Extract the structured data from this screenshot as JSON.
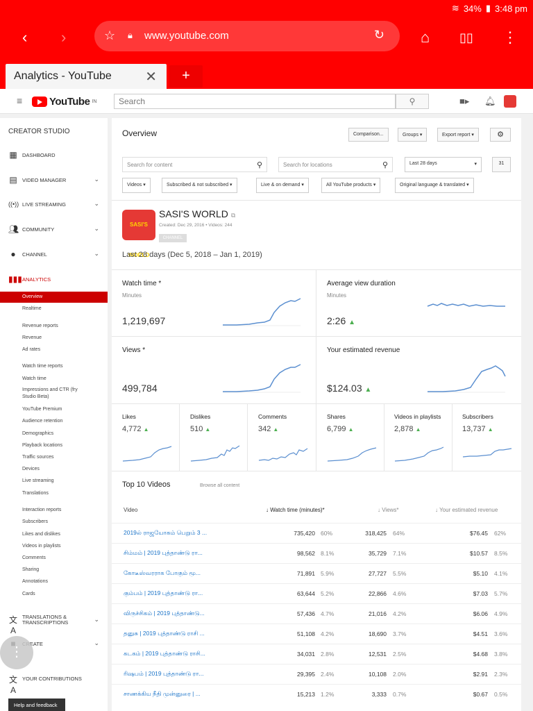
{
  "status": {
    "battery": "34%",
    "time": "3:48 pm"
  },
  "browser": {
    "url": "www.youtube.com",
    "tab_title": "Analytics - YouTube",
    "new_tab": "+"
  },
  "yt": {
    "logo": "YouTube",
    "region": "IN",
    "search_placeholder": "Search"
  },
  "sidebar": {
    "header": "CREATOR STUDIO",
    "items": [
      {
        "label": "DASHBOARD",
        "icon": "dashboard-icon"
      },
      {
        "label": "VIDEO MANAGER",
        "icon": "video-manager-icon"
      },
      {
        "label": "LIVE STREAMING",
        "icon": "live-icon"
      },
      {
        "label": "COMMUNITY",
        "icon": "community-icon"
      },
      {
        "label": "CHANNEL",
        "icon": "channel-icon"
      },
      {
        "label": "ANALYTICS",
        "icon": "analytics-icon"
      }
    ],
    "analytics_sub": [
      "Overview",
      "Realtime",
      "Revenue reports",
      "Revenue",
      "Ad rates",
      "Watch time reports",
      "Watch time",
      "Impressions and CTR (fry",
      "Studio Beta)",
      "YouTube Premium",
      "Audience retention",
      "Demographics",
      "Playback locations",
      "Traffic sources",
      "Devices",
      "Live streaming",
      "Translations",
      "Interaction reports",
      "Subscribers",
      "Likes and dislikes",
      "Videos in playlists",
      "Comments",
      "Sharing",
      "Annotations",
      "Cards"
    ],
    "bottom_items": [
      {
        "label": "TRANSLATIONS &",
        "label2": "TRANSCRIPTIONS",
        "icon": "translate-icon"
      },
      {
        "label": "CREATE",
        "icon": "create-icon"
      },
      {
        "label": "YOUR CONTRIBUTIONS",
        "icon": "contributions-icon"
      }
    ],
    "help": "Help and feedback"
  },
  "main": {
    "title": "Overview",
    "buttons": {
      "comparison": "Comparison...",
      "groups": "Groups",
      "export": "Export report"
    },
    "search_content": "Search for content",
    "search_locations": "Search for locations",
    "date_range": "Last 28 days",
    "calendar_day": "31",
    "filters": [
      "Videos",
      "Subscribed & not subscribed",
      "Live & on demand",
      "All YouTube products",
      "Original language & translated"
    ],
    "channel": {
      "name": "SASI'S WORLD",
      "meta": "Created: Dec 29, 2016  •  Videos: 244",
      "badge": "CHANNEL",
      "logo_text": "SASI'S WORLD"
    },
    "range": "Last 28 days (Dec 5, 2018 – Jan 1, 2019)",
    "metrics": {
      "watch_time": {
        "label": "Watch time *",
        "unit": "Minutes",
        "value": "1,219,697"
      },
      "avg_view": {
        "label": "Average view duration",
        "unit": "Minutes",
        "value": "2:26"
      },
      "views": {
        "label": "Views *",
        "value": "499,784"
      },
      "revenue": {
        "label": "Your estimated revenue",
        "value": "$124.03"
      }
    },
    "small": [
      {
        "label": "Likes",
        "value": "4,772"
      },
      {
        "label": "Dislikes",
        "value": "510"
      },
      {
        "label": "Comments",
        "value": "342"
      },
      {
        "label": "Shares",
        "value": "6,799"
      },
      {
        "label": "Videos in playlists",
        "value": "2,878"
      },
      {
        "label": "Subscribers",
        "value": "13,737"
      }
    ],
    "top10": {
      "title": "Top 10 Videos",
      "browse": "Browse all content",
      "headers": {
        "video": "Video",
        "watch": "Watch time (minutes)*",
        "views": "Views*",
        "revenue": "Your estimated revenue"
      },
      "rows": [
        {
          "video": "2019ல் ராஜயோகம் பெறும் 3 ...",
          "watch": "735,420",
          "wp": "60%",
          "views": "318,425",
          "vp": "64%",
          "rev": "$76.45",
          "rp": "62%"
        },
        {
          "video": "சிம்மம் | 2019 புத்தாண்டு ரா...",
          "watch": "98,562",
          "wp": "8.1%",
          "views": "35,729",
          "vp": "7.1%",
          "rev": "$10.57",
          "rp": "8.5%"
        },
        {
          "video": "கோடீஸ்வரராக போகும் மூ...",
          "watch": "71,891",
          "wp": "5.9%",
          "views": "27,727",
          "vp": "5.5%",
          "rev": "$5.10",
          "rp": "4.1%"
        },
        {
          "video": "கும்பம் | 2019 புத்தாண்டு ரா...",
          "watch": "63,644",
          "wp": "5.2%",
          "views": "22,866",
          "vp": "4.6%",
          "rev": "$7.03",
          "rp": "5.7%"
        },
        {
          "video": "விருச்சிகம் | 2019 புத்தாண்டு...",
          "watch": "57,436",
          "wp": "4.7%",
          "views": "21,016",
          "vp": "4.2%",
          "rev": "$6.06",
          "rp": "4.9%"
        },
        {
          "video": "தனுசு | 2019 புத்தாண்டு ராசி ...",
          "watch": "51,108",
          "wp": "4.2%",
          "views": "18,690",
          "vp": "3.7%",
          "rev": "$4.51",
          "rp": "3.6%"
        },
        {
          "video": "கடகம் | 2019 புத்தாண்டு ராசி...",
          "watch": "34,031",
          "wp": "2.8%",
          "views": "12,531",
          "vp": "2.5%",
          "rev": "$4.68",
          "rp": "3.8%"
        },
        {
          "video": "ரிஷபம் | 2019 புத்தாண்டு ரா...",
          "watch": "29,395",
          "wp": "2.4%",
          "views": "10,108",
          "vp": "2.0%",
          "rev": "$2.91",
          "rp": "2.3%"
        },
        {
          "video": "சாணக்கிய நீதி முன்னுரை | ...",
          "watch": "15,213",
          "wp": "1.2%",
          "views": "3,333",
          "vp": "0.7%",
          "rev": "$0.67",
          "rp": "0.5%"
        }
      ]
    }
  },
  "colors": {
    "brand": "#ff0000",
    "link": "#1a73c8",
    "up": "#4caf50",
    "spark": "#5b8fd0"
  }
}
